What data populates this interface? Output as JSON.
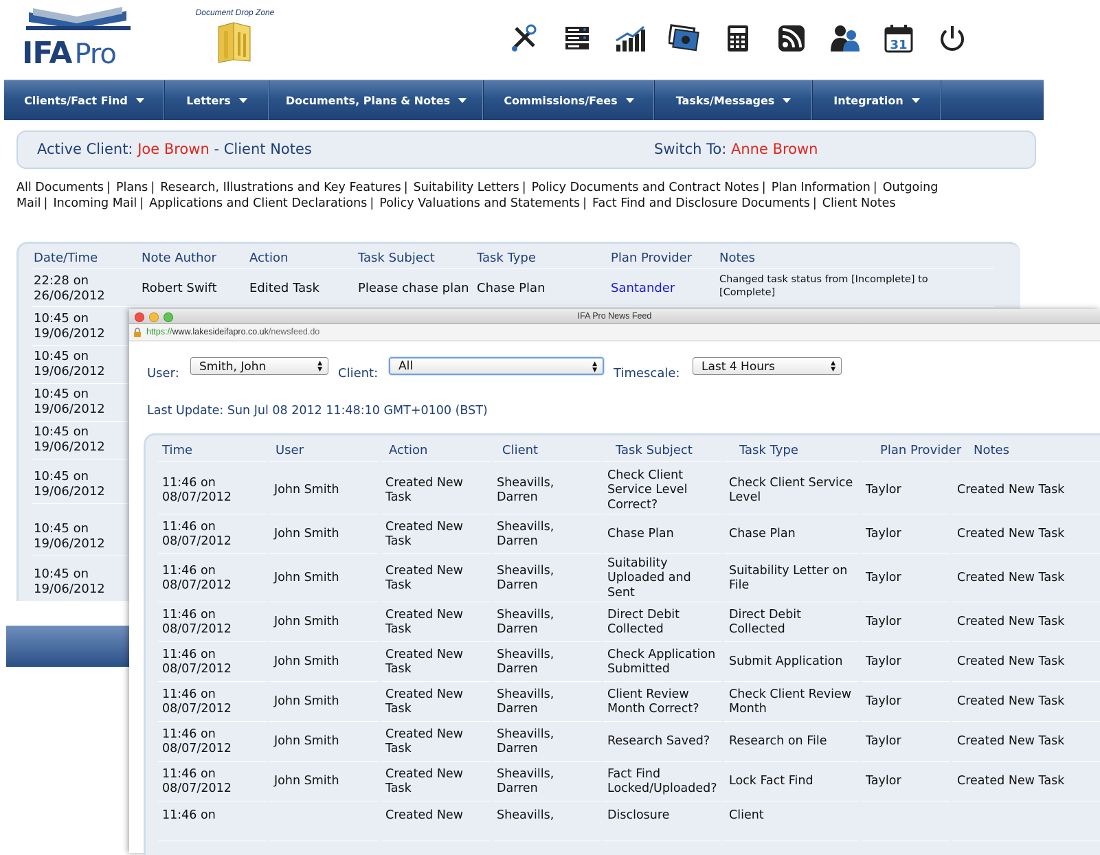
{
  "header": {
    "logo_text": "IFA",
    "logo_sub": "Pro",
    "drop_zone_label": "Document Drop Zone",
    "icons": [
      "tools-icon",
      "server-icon",
      "chart-growth-icon",
      "money-icon",
      "calculator-icon",
      "rss-icon",
      "users-icon",
      "calendar-icon",
      "power-icon"
    ],
    "calendar_day": "31"
  },
  "nav": [
    {
      "label": "Clients/Fact Find"
    },
    {
      "label": "Letters"
    },
    {
      "label": "Documents, Plans & Notes"
    },
    {
      "label": "Commissions/Fees"
    },
    {
      "label": "Tasks/Messages"
    },
    {
      "label": "Integration"
    }
  ],
  "client_bar": {
    "active_label": "Active Client:",
    "active_name": "Joe Brown",
    "dash": "-",
    "page": "Client Notes",
    "switch_label": "Switch To:",
    "switch_name": "Anne Brown"
  },
  "doc_links": [
    "All Documents",
    "Plans",
    "Research, Illustrations and Key Features",
    "Suitability Letters",
    "Policy Documents and Contract Notes",
    "Plan Information",
    "Outgoing Mail",
    "Incoming Mail",
    "Applications and Client Declarations",
    "Policy Valuations and Statements",
    "Fact Find and Disclosure Documents",
    "Client Notes"
  ],
  "notes_table": {
    "headers": [
      "Date/Time",
      "Note Author",
      "Action",
      "Task Subject",
      "Task Type",
      "Plan Provider",
      "Notes"
    ],
    "first_row": {
      "datetime_1": "22:28 on",
      "datetime_2": "26/06/2012",
      "author": "Robert Swift",
      "action": "Edited Task",
      "subject": "Please chase plan",
      "type": "Chase Plan",
      "provider": "Santander",
      "notes_1": "Changed task status from [Incomplete] to",
      "notes_2": "[Complete]"
    },
    "other_dates": [
      [
        "10:45 on",
        "19/06/2012"
      ],
      [
        "10:45 on",
        "19/06/2012"
      ],
      [
        "10:45 on",
        "19/06/2012"
      ],
      [
        "10:45 on",
        "19/06/2012"
      ],
      [
        "10:45 on",
        "19/06/2012"
      ],
      [
        "10:45 on",
        "19/06/2012"
      ],
      [
        "10:45 on",
        "19/06/2012"
      ]
    ]
  },
  "newsfeed": {
    "window_title": "IFA Pro News Feed",
    "url_scheme": "https://",
    "url_host": "www.lakesideifapro.co.uk",
    "url_path": "/newsfeed.do",
    "user_label": "User:",
    "user_value": "Smith, John",
    "client_label": "Client:",
    "client_value": "All",
    "timescale_label": "Timescale:",
    "timescale_value": "Last 4 Hours",
    "last_update": "Last Update: Sun Jul 08 2012 11:48:10 GMT+0100 (BST)",
    "headers": [
      "Time",
      "User",
      "Action",
      "Client",
      "Task Subject",
      "Task Type",
      "Plan Provider",
      "Notes"
    ],
    "rows": [
      {
        "time": [
          "11:46 on",
          "08/07/2012"
        ],
        "user": "John Smith",
        "action": [
          "Created New",
          "Task"
        ],
        "client": [
          "Sheavills,",
          "Darren"
        ],
        "subject": [
          "Check Client",
          "Service Level",
          "Correct?"
        ],
        "type": [
          "Check Client Service",
          "Level"
        ],
        "provider": "Taylor",
        "notes": "Created New Task"
      },
      {
        "time": [
          "11:46 on",
          "08/07/2012"
        ],
        "user": "John Smith",
        "action": [
          "Created New",
          "Task"
        ],
        "client": [
          "Sheavills,",
          "Darren"
        ],
        "subject": [
          "Chase Plan"
        ],
        "type": [
          "Chase Plan"
        ],
        "provider": "Taylor",
        "notes": "Created New Task"
      },
      {
        "time": [
          "11:46 on",
          "08/07/2012"
        ],
        "user": "John Smith",
        "action": [
          "Created New",
          "Task"
        ],
        "client": [
          "Sheavills,",
          "Darren"
        ],
        "subject": [
          "Suitability",
          "Uploaded and",
          "Sent"
        ],
        "type": [
          "Suitability Letter on",
          "File"
        ],
        "provider": "Taylor",
        "notes": "Created New Task"
      },
      {
        "time": [
          "11:46 on",
          "08/07/2012"
        ],
        "user": "John Smith",
        "action": [
          "Created New",
          "Task"
        ],
        "client": [
          "Sheavills,",
          "Darren"
        ],
        "subject": [
          "Direct Debit",
          "Collected"
        ],
        "type": [
          "Direct Debit",
          "Collected"
        ],
        "provider": "Taylor",
        "notes": "Created New Task"
      },
      {
        "time": [
          "11:46 on",
          "08/07/2012"
        ],
        "user": "John Smith",
        "action": [
          "Created New",
          "Task"
        ],
        "client": [
          "Sheavills,",
          "Darren"
        ],
        "subject": [
          "Check Application",
          "Submitted"
        ],
        "type": [
          "Submit Application"
        ],
        "provider": "Taylor",
        "notes": "Created New Task"
      },
      {
        "time": [
          "11:46 on",
          "08/07/2012"
        ],
        "user": "John Smith",
        "action": [
          "Created New",
          "Task"
        ],
        "client": [
          "Sheavills,",
          "Darren"
        ],
        "subject": [
          "Client Review",
          "Month Correct?"
        ],
        "type": [
          "Check Client Review",
          "Month"
        ],
        "provider": "Taylor",
        "notes": "Created New Task"
      },
      {
        "time": [
          "11:46 on",
          "08/07/2012"
        ],
        "user": "John Smith",
        "action": [
          "Created New",
          "Task"
        ],
        "client": [
          "Sheavills,",
          "Darren"
        ],
        "subject": [
          "Research Saved?"
        ],
        "type": [
          "Research on File"
        ],
        "provider": "Taylor",
        "notes": "Created New Task"
      },
      {
        "time": [
          "11:46 on",
          "08/07/2012"
        ],
        "user": "John Smith",
        "action": [
          "Created New",
          "Task"
        ],
        "client": [
          "Sheavills,",
          "Darren"
        ],
        "subject": [
          "Fact Find",
          "Locked/Uploaded?"
        ],
        "type": [
          "Lock Fact Find"
        ],
        "provider": "Taylor",
        "notes": "Created New Task"
      },
      {
        "time": [
          "11:46 on",
          ""
        ],
        "user": "",
        "action": [
          "Created New",
          ""
        ],
        "client": [
          "Sheavills,",
          ""
        ],
        "subject": [
          "Disclosure",
          ""
        ],
        "type": [
          "Client",
          ""
        ],
        "provider": "",
        "notes": ""
      }
    ]
  },
  "colors": {
    "nav_top": "#577aac",
    "nav_bottom": "#1f4276",
    "accent_red": "#e1251b",
    "heading_blue": "#1f3f78",
    "panel_bg": "#e9eef5",
    "link_blue": "#1a1ad6"
  }
}
